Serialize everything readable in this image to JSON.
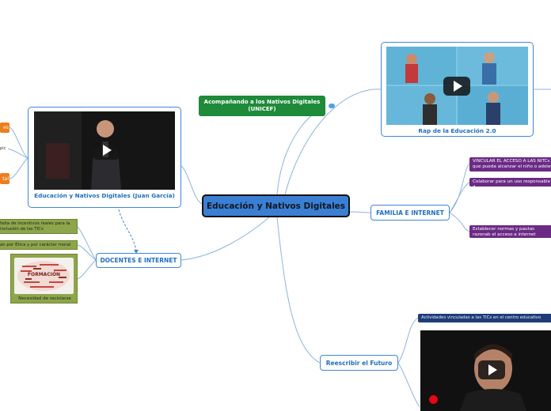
{
  "central": {
    "label": "Educación y Nativos Digitales"
  },
  "unicef": {
    "label": "Acompañando a los Nativos Digitales (UNICEF)"
  },
  "rap": {
    "caption": "Rap de la Educación 2.0"
  },
  "juan": {
    "caption": "Educación y Nativos Digitales (Juan García)"
  },
  "familia": {
    "label": "FAMILIA E INTERNET",
    "items": [
      "VINCULAR EL ACCESO A LAS NITCs que pueda alcanzar el niño o adoles",
      "Colaborar para un uso responsable d",
      "Establecer normas y pautas razonab el acceso a internet"
    ]
  },
  "docentes": {
    "label": "DOCENTES E INTERNET",
    "items": [
      "falta de incentivos reales para la inclusión de las TICs",
      "an por Ética y por carácter moral"
    ],
    "image_caption": "Necesidad de reciclarse",
    "wordcloud_word": "FORMACIÓN"
  },
  "futuro": {
    "label": "Reescribir el Futuro",
    "item": "Actividades vinculadas a las TICs en el centro educativo"
  },
  "left_fragments": {
    "top": "es",
    "middle": "pic",
    "bottom": "tal"
  },
  "colors": {
    "central": "#3b7fd4",
    "branch_blue": "#3f87d6",
    "green": "#1e8a3a",
    "purple": "#6b2b85",
    "olive": "#8da64a",
    "orange": "#ee7d1e",
    "navy": "#1f3c78"
  },
  "icons": [
    "play-icon",
    "chat-icon",
    "vodafone-logo-icon"
  ]
}
